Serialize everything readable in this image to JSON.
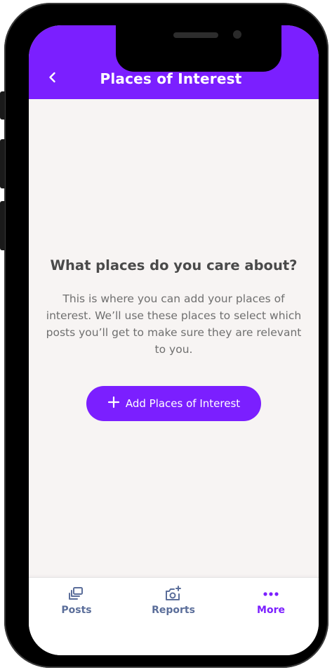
{
  "header": {
    "title": "Places of Interest"
  },
  "empty_state": {
    "heading": "What places do you care about?",
    "description": "This is where you can add your places of interest. We’ll use these places to select which posts you’ll get to make sure they are relevant to you.",
    "button_label": "Add Places of Interest"
  },
  "tabbar": {
    "items": [
      {
        "label": "Posts",
        "icon": "posts-icon",
        "active": false
      },
      {
        "label": "Reports",
        "icon": "camera-add-icon",
        "active": false
      },
      {
        "label": "More",
        "icon": "more-dots-icon",
        "active": true
      }
    ]
  },
  "colors": {
    "accent": "#7b1fff",
    "background": "#f7f4f3",
    "inactive_tab": "#5b6e9a"
  }
}
